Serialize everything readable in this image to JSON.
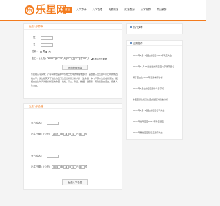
{
  "site": {
    "logo_char": "乐",
    "logo_text": "乐星网"
  },
  "nav": [
    "首页",
    "八字算命",
    "八字合婚",
    "免费测名",
    "姓名配对",
    "八字测算",
    "周公解梦"
  ],
  "form1": {
    "title": "免费八字算命",
    "name_label": "姓：",
    "given_label": "名：",
    "gender_label": "性别：",
    "male": "男",
    "female": "女",
    "birth_label": "生日：",
    "birth_prefix": "(公历)",
    "year": "2003",
    "year_unit": "年",
    "month": "12",
    "month_unit": "月",
    "day": "1",
    "day_unit": "日",
    "hour": "0",
    "hour_unit": "时",
    "minute": "00",
    "minute_unit": "分",
    "unknown_label": "不知道出生时辰",
    "submit": "开始免费测算",
    "desc": "乐星网八字算命：八字算命也是中华传统文化中的命理学部分，是根据人出生的年月日时排成四柱八字，通过推算天干地支的五行生克关系来分析人的一生命运。本八字算命免费在线测试，能结合出生时间详细分析您的命理、性格、事业、财运、婚姻、健康等，帮助您趋吉避凶，把握人生方向。"
  },
  "form2": {
    "title": "免费八字合婚",
    "male_name_label": "男方姓名：",
    "male_birth_label": "出生日期：(公历)",
    "male_year": "2003",
    "year_unit": "年",
    "male_month": "12",
    "month_unit": "月",
    "male_day": "1",
    "day_unit": "日",
    "male_hour": "0",
    "hour_unit": "时",
    "female_name_label": "女方姓名：",
    "female_birth_label": "出生日期：(公历)",
    "female_year": "1999",
    "female_month": "12",
    "female_day": "1",
    "female_hour": "0",
    "submit": "免费八字合婚"
  },
  "sidebar": {
    "hot_title": "热门文章",
    "news_title": "近期推荐",
    "items": [
      "2024年6月11日生的宝宝2024年乳名大全",
      "2024年11月12日出生的男宝宝八字测算起名",
      "狮子座女生2024年运势详解分析",
      "2024年4月生的宝宝起什么名字好",
      "水瓶座男生和双鱼座女生配对指数分析",
      "2024年4月17日生的宝宝名字大全",
      "2024年龙年宝宝2024年乳名起名",
      "2024年属龙宝宝起名宜用字大全"
    ]
  },
  "colors": {
    "accent": "#f37b1d",
    "blue": "#3a6fb0"
  }
}
